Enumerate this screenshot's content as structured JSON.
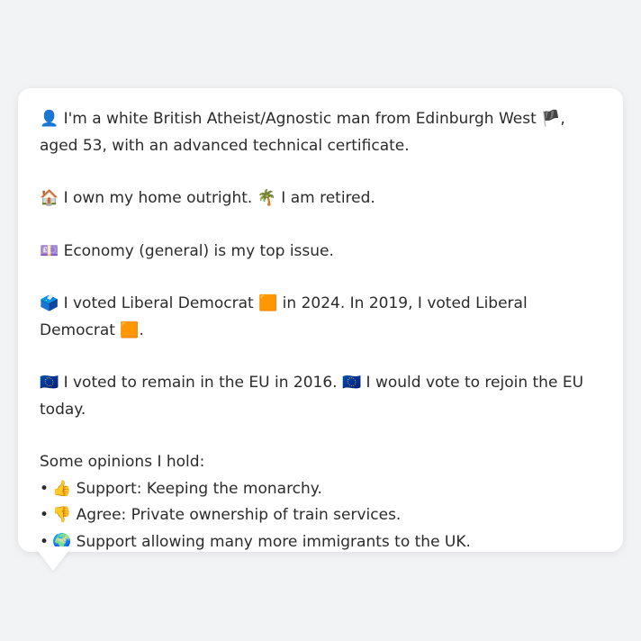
{
  "profile": {
    "identity": {
      "icon": "👤",
      "text_before_flag": " I'm a white British Atheist/Agnostic man from Edinburgh West ",
      "flag": "🏴",
      "text_after_flag": ", aged 53, with an advanced technical certificate."
    },
    "home": {
      "home_icon": "🏠",
      "home_text": " I own my home outright. ",
      "status_icon": "🌴",
      "status_text": " I am retired."
    },
    "issue": {
      "icon": "💷",
      "text": " Economy (general) is my top issue."
    },
    "vote": {
      "icon": "🗳️",
      "text_1": " I voted Liberal Democrat ",
      "party_icon_1": "🟧",
      "text_2": " in 2024. In 2019, I voted Liberal Democrat ",
      "party_icon_2": "🟧",
      "text_3": "."
    },
    "eu": {
      "icon_1": "🇪🇺",
      "text_1": " I voted to remain in the EU in 2016. ",
      "icon_2": "🇪🇺",
      "text_2": " I would vote to rejoin the EU today."
    },
    "opinions": {
      "heading": "Some opinions I hold:",
      "bullet": "•",
      "items": [
        {
          "icon": "👍",
          "text": " Support: Keeping the monarchy."
        },
        {
          "icon": "👎",
          "text": " Agree: Private ownership of train services."
        },
        {
          "icon": "🌍",
          "text": " Support allowing many more immigrants to the UK."
        }
      ]
    }
  },
  "colors": {
    "background": "#f2f3f5",
    "card": "#ffffff",
    "text": "#2b2b2b"
  }
}
